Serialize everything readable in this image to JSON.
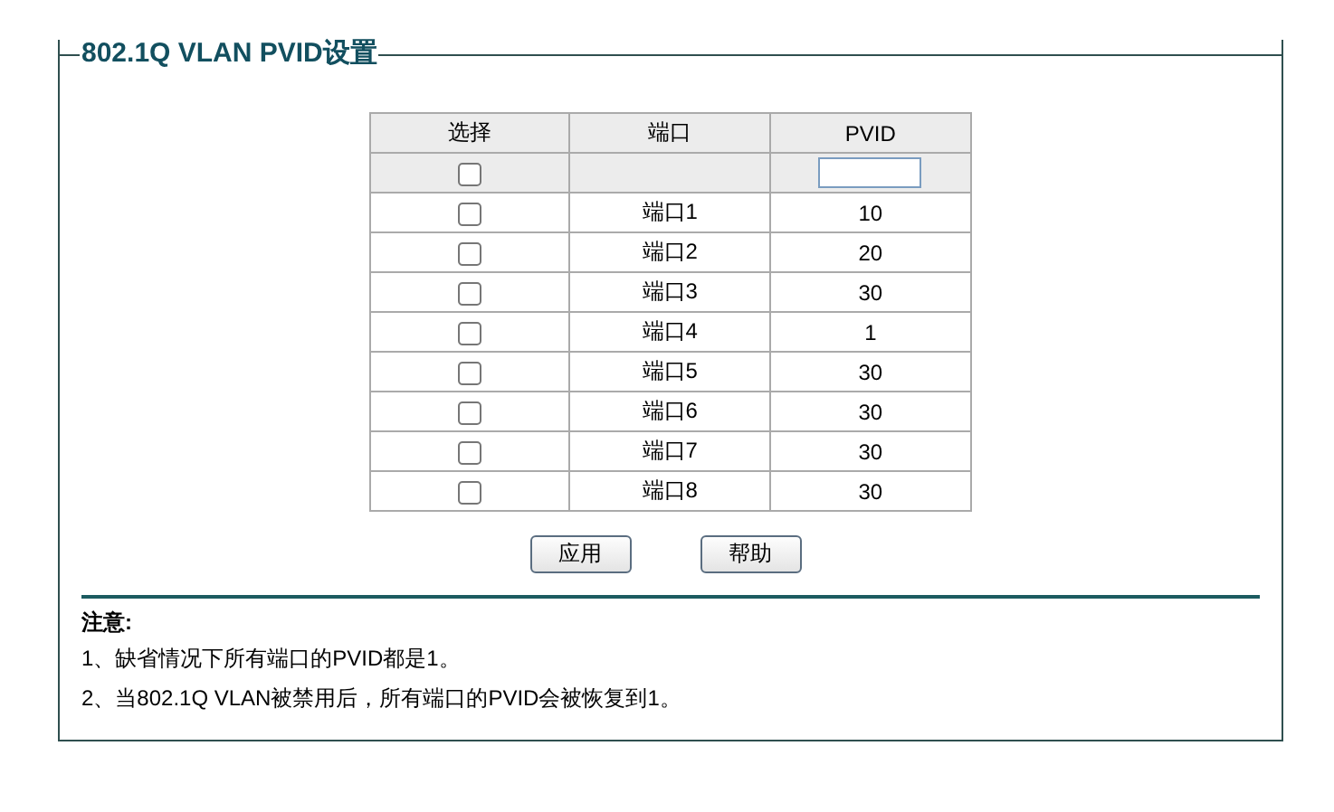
{
  "panel": {
    "title": "802.1Q VLAN PVID设置"
  },
  "table": {
    "columns": [
      "选择",
      "端口",
      "PVID"
    ],
    "select_all": {
      "checked": false
    },
    "rows": [
      {
        "checked": false,
        "port": "端口1",
        "pvid": "10"
      },
      {
        "checked": false,
        "port": "端口2",
        "pvid": "20"
      },
      {
        "checked": false,
        "port": "端口3",
        "pvid": "30"
      },
      {
        "checked": false,
        "port": "端口4",
        "pvid": "1"
      },
      {
        "checked": false,
        "port": "端口5",
        "pvid": "30"
      },
      {
        "checked": false,
        "port": "端口6",
        "pvid": "30"
      },
      {
        "checked": false,
        "port": "端口7",
        "pvid": "30"
      },
      {
        "checked": false,
        "port": "端口8",
        "pvid": "30"
      }
    ]
  },
  "buttons": [
    "应用",
    "帮助"
  ],
  "notes": {
    "heading": "注意:",
    "lines": [
      "1、缺省情况下所有端口的PVID都是1。",
      "2、当802.1Q VLAN被禁用后，所有端口的PVID会被恢复到1。"
    ]
  }
}
